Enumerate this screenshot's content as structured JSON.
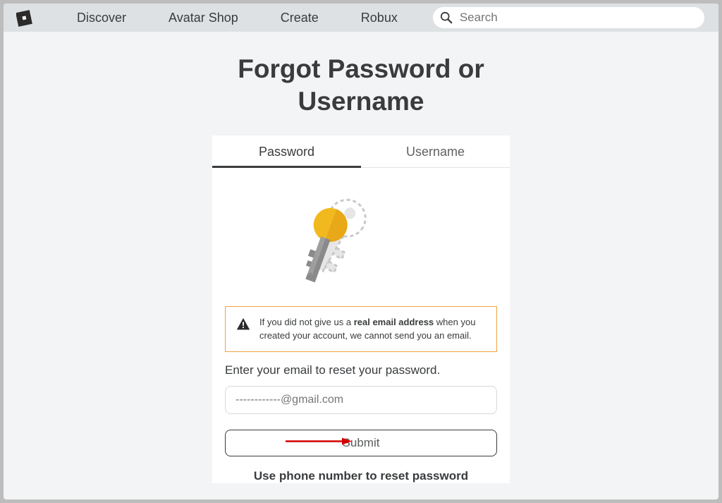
{
  "nav": {
    "links": [
      "Discover",
      "Avatar Shop",
      "Create",
      "Robux"
    ],
    "search_placeholder": "Search"
  },
  "page": {
    "title": "Forgot Password or Username"
  },
  "tabs": {
    "password": "Password",
    "username": "Username",
    "active": "password"
  },
  "alert": {
    "pre": "If you did not give us a ",
    "bold": "real email address",
    "post": " when you created your account, we cannot send you an email."
  },
  "form": {
    "instruction": "Enter your email to reset your password.",
    "email_value": "------------@gmail.com",
    "submit_label": "Submit",
    "phone_link": "Use phone number to reset password"
  }
}
